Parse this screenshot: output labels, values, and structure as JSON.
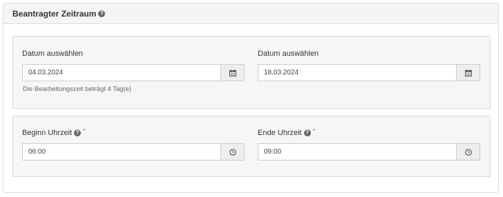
{
  "panel": {
    "title": "Beantragter Zeitraum"
  },
  "date_section": {
    "start": {
      "label": "Datum auswählen",
      "value": "04.03.2024"
    },
    "end": {
      "label": "Datum auswählen",
      "value": "18.03.2024"
    },
    "hint": "Die Bearbeitungszeit beträgt 4 Tag(e)"
  },
  "time_section": {
    "start": {
      "label": "Beginn Uhrzeit",
      "required_mark": "*",
      "value": "06:00"
    },
    "end": {
      "label": "Ende Uhrzeit",
      "required_mark": "*",
      "value": "09:00"
    }
  },
  "icons": {
    "help": "help-circle-icon",
    "date": "calendar-icon",
    "time": "clock-icon"
  },
  "colors": {
    "required": "#d9534f",
    "section_bg": "#f4f6f8",
    "addon_bg": "#eeeeee"
  }
}
